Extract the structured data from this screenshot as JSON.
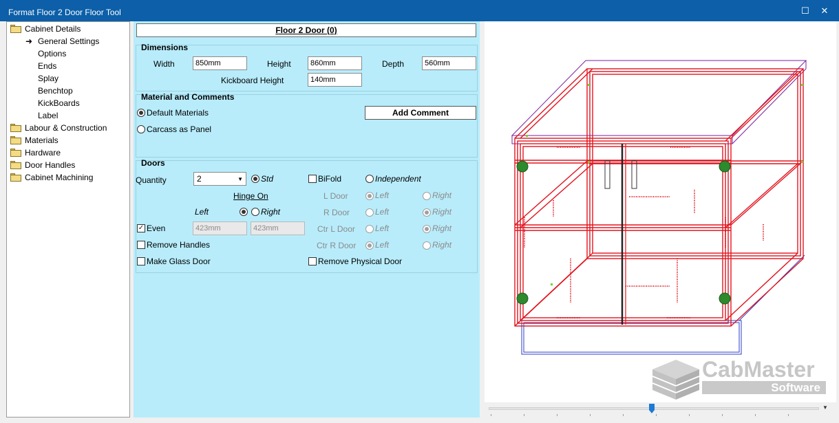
{
  "window": {
    "title": "Format Floor 2 Door Floor Tool",
    "maximize_icon": "maximize-icon",
    "close_icon": "close-icon"
  },
  "tree": {
    "items": [
      {
        "label": "Cabinet Details",
        "icon": "folder-open-icon"
      },
      {
        "label": "General Settings",
        "icon": "arrow-right-icon"
      },
      {
        "label": "Options"
      },
      {
        "label": "Ends"
      },
      {
        "label": "Splay"
      },
      {
        "label": "Benchtop"
      },
      {
        "label": "KickBoards"
      },
      {
        "label": "Label"
      },
      {
        "label": "Labour & Construction",
        "icon": "folder-icon"
      },
      {
        "label": "Materials",
        "icon": "folder-icon"
      },
      {
        "label": "Hardware",
        "icon": "folder-icon"
      },
      {
        "label": "Door Handles",
        "icon": "folder-icon"
      },
      {
        "label": "Cabinet Machining",
        "icon": "folder-icon"
      }
    ]
  },
  "form": {
    "header": "Floor 2 Door (0)",
    "dimensions": {
      "title": "Dimensions",
      "width_label": "Width",
      "width_value": "850mm",
      "height_label": "Height",
      "height_value": "860mm",
      "depth_label": "Depth",
      "depth_value": "560mm",
      "kickboard_label": "Kickboard Height",
      "kickboard_value": "140mm"
    },
    "material": {
      "title": "Material and Comments",
      "default_materials": "Default Materials",
      "carcass_as_panel": "Carcass as Panel",
      "add_comment": "Add Comment"
    },
    "doors": {
      "title": "Doors",
      "quantity_label": "Quantity",
      "quantity_value": "2",
      "std_label": "Std",
      "bifold_label": "BiFold",
      "independent_label": "Independent",
      "hinge_on": "Hinge On",
      "left_label": "Left",
      "right_label": "Right",
      "l_door": "L Door",
      "r_door": "R Door",
      "ctr_l_door": "Ctr L Door",
      "ctr_r_door": "Ctr R Door",
      "even_label": "Even",
      "even_left_value": "423mm",
      "even_right_value": "423mm",
      "remove_handles": "Remove Handles",
      "make_glass_door": "Make Glass Door",
      "remove_physical_door": "Remove Physical Door"
    }
  },
  "logo": {
    "name": "CabMaster",
    "sub": "Software"
  }
}
